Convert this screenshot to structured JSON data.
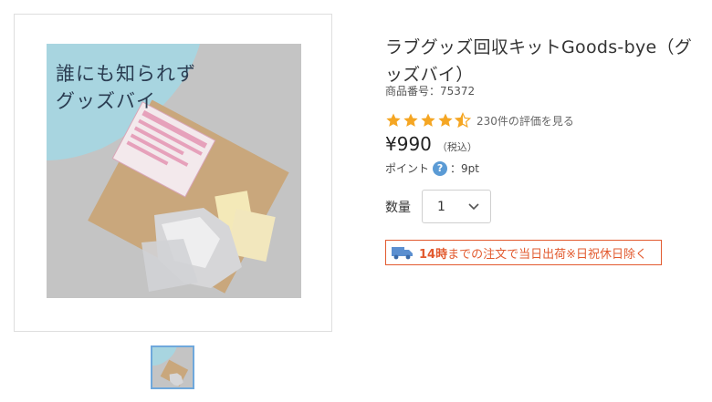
{
  "gallery": {
    "main_alt": "ラブグッズ回収キット商品写真",
    "catchcopy": "誰にも知られず\nグッズバイ",
    "accent_color": "#a8d5e0"
  },
  "product": {
    "title": "ラブグッズ回収キットGoods-bye（グッズバイ）",
    "sku_label": "商品番号：",
    "sku_value": "75372",
    "rating_value": 4.5,
    "review_text": "230件の評価を見る",
    "star_color": "#f5a623",
    "price": "¥990",
    "tax_note": "（税込）",
    "points_label": "ポイント",
    "points_value": "：9pt",
    "help_icon": "question-icon",
    "quantity_label": "数量",
    "quantity_value": "1",
    "shipping_hour": "14時",
    "shipping_text": "までの注文で当日出荷※日祝休日除く",
    "shipping_color": "#e25a2f"
  }
}
